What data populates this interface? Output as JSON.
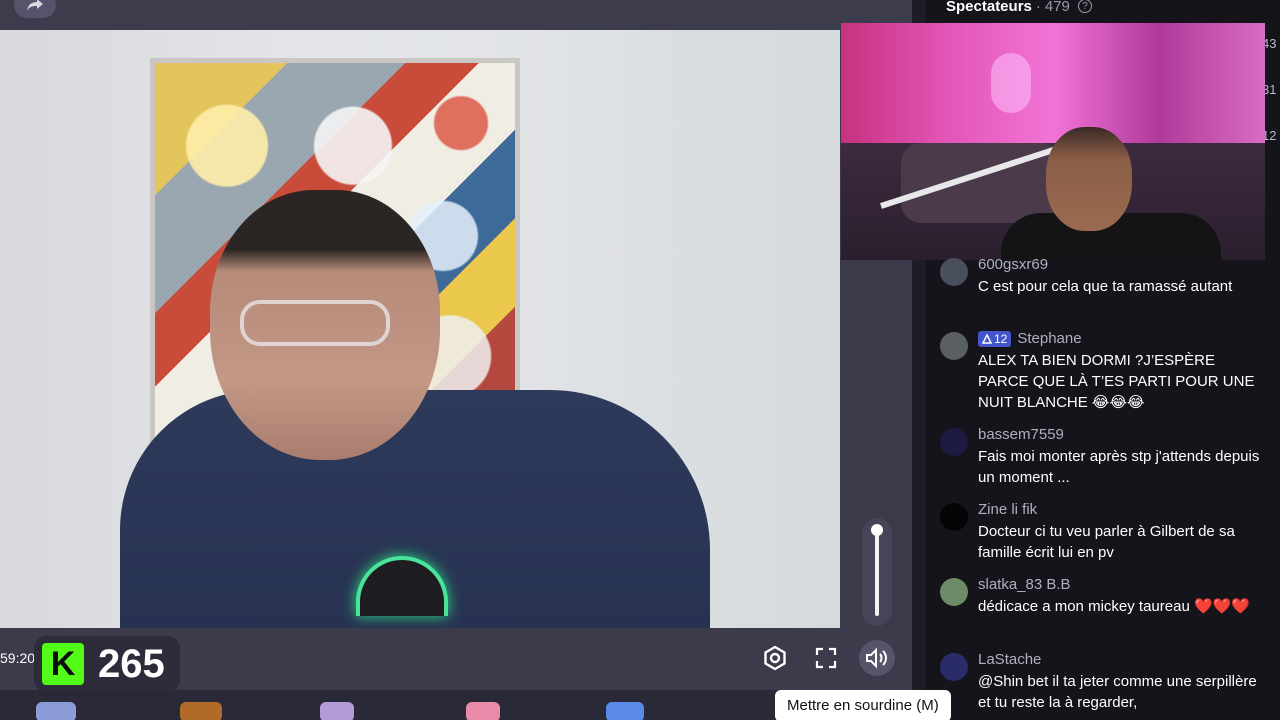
{
  "player": {
    "time": "59:20",
    "viewer_count": "265",
    "kick_letter": "K",
    "tooltip": "Mettre en sourdine (M)",
    "volume_level": 1.0
  },
  "chat": {
    "header_title": "Spectateurs",
    "header_sep": "·",
    "header_count": "479",
    "help_glyph": "?",
    "side_numbers": [
      "43",
      "31",
      "12"
    ],
    "sub_badge_count": "12",
    "messages": [
      {
        "user": "600gsxr69",
        "text": "C est pour cela que ta ramassé autant"
      },
      {
        "user": "Stephane",
        "text": "ALEX TA BIEN DORMI ?J’ESPÈRE PARCE QUE LÀ T’ES PARTI POUR UNE NUIT BLANCHE 😂😂😂"
      },
      {
        "user": "bassem7559",
        "text": "Fais moi monter après stp j'attends depuis un moment ..."
      },
      {
        "user": "Zine li fik",
        "text": "Docteur ci tu veu parler à Gilbert de sa famille écrit lui en pv"
      },
      {
        "user": "slatka_83 B.B",
        "text": "dédicace a mon mickey taureau ❤️❤️❤️"
      },
      {
        "user": "LaStache",
        "text": "@Shin bet il ta jeter comme une serpillère et tu reste la à regarder,"
      }
    ]
  },
  "colors": {
    "kick_green": "#53fc18",
    "sub_badge": "#4455cc",
    "mic_glow": "#49e39a"
  },
  "icons": [
    "share-icon",
    "settings-icon",
    "fullscreen-icon",
    "volume-icon",
    "help-icon"
  ]
}
